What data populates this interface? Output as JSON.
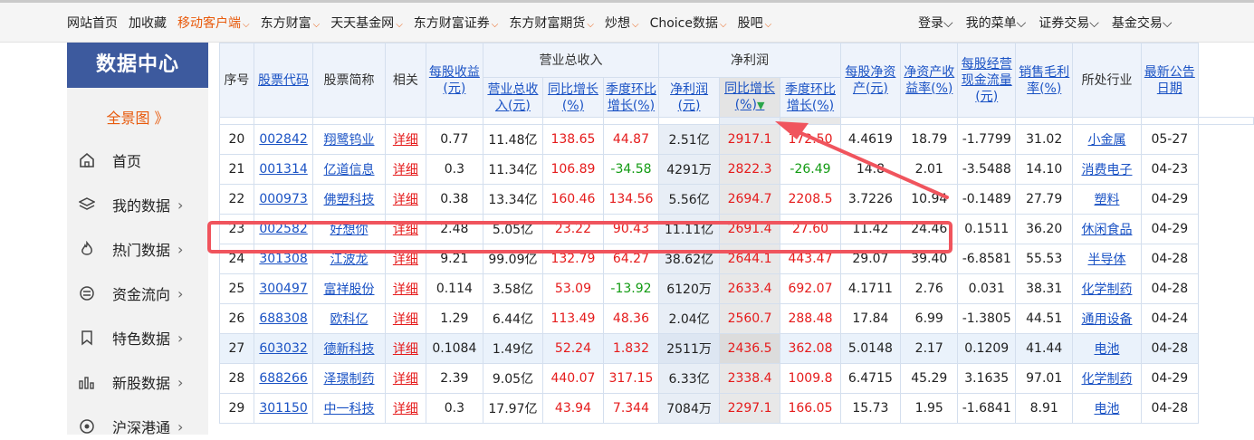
{
  "topnav": {
    "left": [
      {
        "label": "网站首页",
        "caret": false,
        "orange": false
      },
      {
        "label": "加收藏",
        "caret": false,
        "orange": false
      },
      {
        "label": "移动客户端",
        "caret": true,
        "orange": true
      },
      {
        "label": "东方财富",
        "caret": true,
        "orange": false
      },
      {
        "label": "天天基金网",
        "caret": true,
        "orange": false
      },
      {
        "label": "东方财富证券",
        "caret": true,
        "orange": false
      },
      {
        "label": "东方财富期货",
        "caret": true,
        "orange": false
      },
      {
        "label": "炒想",
        "caret": true,
        "orange": false
      },
      {
        "label": "Choice数据",
        "caret": true,
        "orange": false
      },
      {
        "label": "股吧",
        "caret": true,
        "orange": false
      }
    ],
    "right": [
      {
        "label": "登录",
        "caret": true
      },
      {
        "label": "我的菜单",
        "caret": true
      },
      {
        "label": "证券交易",
        "caret": true
      },
      {
        "label": "基金交易",
        "caret": true
      }
    ]
  },
  "sidebar": {
    "title": "数据中心",
    "overview": "全景图 》",
    "items": [
      {
        "label": "首页",
        "icon": "home-icon",
        "arrow": ""
      },
      {
        "label": "我的数据",
        "icon": "layers-icon",
        "arrow": "›"
      },
      {
        "label": "热门数据",
        "icon": "fire-icon",
        "arrow": "›"
      },
      {
        "label": "资金流向",
        "icon": "money-flow-icon",
        "arrow": "›"
      },
      {
        "label": "特色数据",
        "icon": "bookmark-icon",
        "arrow": "›"
      },
      {
        "label": "新股数据",
        "icon": "bar-chart-icon",
        "arrow": "›"
      },
      {
        "label": "沪深港通",
        "icon": "connect-icon",
        "arrow": "›"
      }
    ]
  },
  "table": {
    "headers": {
      "seq": "序号",
      "code": "股票代码",
      "name": "股票简称",
      "related": "相关",
      "eps": "每股收益(元)",
      "revenue": "营业总收入",
      "net_profit": "净利润",
      "rev_total": "营业总收入(元)",
      "rev_yoy": "同比增长(%)",
      "rev_qoq": "季度环比增长(%)",
      "np_total": "净利润(元)",
      "np_yoy": "同比增长(%)",
      "np_qoq": "季度环比增长(%)",
      "bvps": "每股净资产(元)",
      "roe": "净资产收益率(%)",
      "cfps": "每股经营现金流量(元)",
      "gross": "销售毛利率(%)",
      "industry": "所处行业",
      "date": "最新公告日期"
    },
    "rows": [
      {
        "seq": "20",
        "code": "002842",
        "name": "翔鹭钨业",
        "link": "详细",
        "eps": "0.77",
        "rev": "11.48亿",
        "rev_yoy": "138.65",
        "rev_qoq": "44.87",
        "np": "2.51亿",
        "np_yoy": "2917.1",
        "np_qoq": "172.50",
        "bvps": "4.4619",
        "roe": "18.79",
        "cfps": "-1.7799",
        "gross": "31.02",
        "industry": "小金属",
        "date": "05-27"
      },
      {
        "seq": "21",
        "code": "001314",
        "name": "亿道信息",
        "link": "详细",
        "eps": "0.3",
        "rev": "11.34亿",
        "rev_yoy": "106.89",
        "rev_qoq": "-34.58",
        "np": "4291万",
        "np_yoy": "2822.3",
        "np_qoq": "-26.49",
        "bvps": "14.8",
        "roe": "2.01",
        "cfps": "-3.5488",
        "gross": "14.10",
        "industry": "消费电子",
        "date": "04-23"
      },
      {
        "seq": "22",
        "code": "000973",
        "name": "佛塑科技",
        "link": "详细",
        "eps": "0.38",
        "rev": "13.34亿",
        "rev_yoy": "160.46",
        "rev_qoq": "134.56",
        "np": "5.56亿",
        "np_yoy": "2694.7",
        "np_qoq": "2208.5",
        "bvps": "3.7226",
        "roe": "10.94",
        "cfps": "-0.1489",
        "gross": "27.79",
        "industry": "塑料",
        "date": "04-29"
      },
      {
        "seq": "23",
        "code": "002582",
        "name": "好想你",
        "link": "详细",
        "eps": "2.48",
        "rev": "5.05亿",
        "rev_yoy": "23.22",
        "rev_qoq": "90.43",
        "np": "11.11亿",
        "np_yoy": "2691.4",
        "np_qoq": "27.60",
        "bvps": "11.42",
        "roe": "24.46",
        "cfps": "0.1511",
        "gross": "36.20",
        "industry": "休闲食品",
        "date": "04-29"
      },
      {
        "seq": "24",
        "code": "301308",
        "name": "江波龙",
        "link": "详细",
        "eps": "9.21",
        "rev": "99.09亿",
        "rev_yoy": "132.79",
        "rev_qoq": "64.27",
        "np": "38.62亿",
        "np_yoy": "2644.1",
        "np_qoq": "443.47",
        "bvps": "29.07",
        "roe": "39.40",
        "cfps": "-6.8581",
        "gross": "55.53",
        "industry": "半导体",
        "date": "04-28"
      },
      {
        "seq": "25",
        "code": "300497",
        "name": "富祥股份",
        "link": "详细",
        "eps": "0.114",
        "rev": "3.58亿",
        "rev_yoy": "53.09",
        "rev_qoq": "-13.92",
        "np": "6120万",
        "np_yoy": "2633.4",
        "np_qoq": "692.07",
        "bvps": "4.1711",
        "roe": "2.76",
        "cfps": "0.031",
        "gross": "38.31",
        "industry": "化学制药",
        "date": "04-28"
      },
      {
        "seq": "26",
        "code": "688308",
        "name": "欧科亿",
        "link": "详细",
        "eps": "1.29",
        "rev": "6.44亿",
        "rev_yoy": "113.49",
        "rev_qoq": "48.36",
        "np": "2.04亿",
        "np_yoy": "2560.7",
        "np_qoq": "288.48",
        "bvps": "17.84",
        "roe": "6.99",
        "cfps": "-1.3805",
        "gross": "44.51",
        "industry": "通用设备",
        "date": "04-24"
      },
      {
        "seq": "27",
        "code": "603032",
        "name": "德新科技",
        "link": "详细",
        "eps": "0.1084",
        "rev": "1.49亿",
        "rev_yoy": "52.24",
        "rev_qoq": "1.832",
        "np": "2511万",
        "np_yoy": "2436.5",
        "np_qoq": "362.08",
        "bvps": "5.0148",
        "roe": "2.17",
        "cfps": "0.1209",
        "gross": "41.44",
        "industry": "电池",
        "date": "04-28"
      },
      {
        "seq": "28",
        "code": "688266",
        "name": "泽璟制药",
        "link": "详细",
        "eps": "2.39",
        "rev": "9.05亿",
        "rev_yoy": "440.07",
        "rev_qoq": "317.15",
        "np": "6.33亿",
        "np_yoy": "2338.4",
        "np_qoq": "1009.8",
        "bvps": "6.4715",
        "roe": "45.29",
        "cfps": "3.1635",
        "gross": "97.01",
        "industry": "化学制药",
        "date": "04-29"
      },
      {
        "seq": "29",
        "code": "301150",
        "name": "中一科技",
        "link": "详细",
        "eps": "0.3",
        "rev": "17.97亿",
        "rev_yoy": "43.94",
        "rev_qoq": "7.344",
        "np": "7084万",
        "np_yoy": "2297.1",
        "np_qoq": "166.05",
        "bvps": "15.73",
        "roe": "1.95",
        "cfps": "-1.6841",
        "gross": "8.91",
        "industry": "电池",
        "date": "04-28"
      }
    ]
  },
  "colors": {
    "accent": "#e85a0c",
    "link": "#1a52c4",
    "positive": "#e51b1b",
    "negative": "#129b12",
    "logo_bg": "#3d5a9e",
    "annotation": "#f0545d"
  }
}
